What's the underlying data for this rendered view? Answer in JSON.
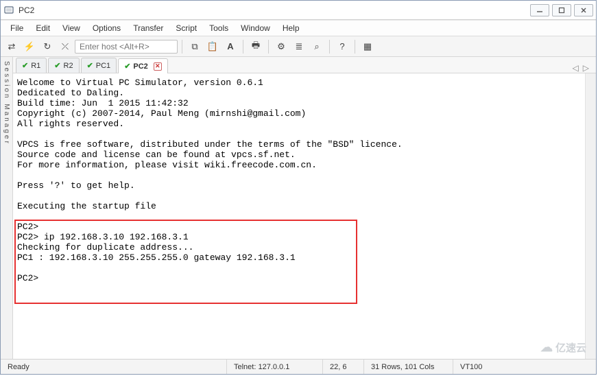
{
  "window": {
    "title": "PC2",
    "min_tip": "Minimize",
    "max_tip": "Maximize",
    "close_tip": "Close"
  },
  "menu": {
    "file": "File",
    "edit": "Edit",
    "view": "View",
    "options": "Options",
    "transfer": "Transfer",
    "script": "Script",
    "tools": "Tools",
    "window": "Window",
    "help": "Help"
  },
  "toolbar": {
    "host_placeholder": "Enter host <Alt+R>"
  },
  "session_manager_label": "Session Manager",
  "tabs": {
    "items": [
      {
        "label": "R1",
        "active": false
      },
      {
        "label": "R2",
        "active": false
      },
      {
        "label": "PC1",
        "active": false
      },
      {
        "label": "PC2",
        "active": true
      }
    ]
  },
  "terminal": {
    "header_lines": "Welcome to Virtual PC Simulator, version 0.6.1\nDedicated to Daling.\nBuild time: Jun  1 2015 11:42:32\nCopyright (c) 2007-2014, Paul Meng (mirnshi@gmail.com)\nAll rights reserved.\n\nVPCS is free software, distributed under the terms of the \"BSD\" licence.\nSource code and license can be found at vpcs.sf.net.\nFor more information, please visit wiki.freecode.com.cn.\n\nPress '?' to get help.\n\nExecuting the startup file\n",
    "boxed_lines": "PC2>\nPC2> ip 192.168.3.10 192.168.3.1\nChecking for duplicate address...\nPC1 : 192.168.3.10 255.255.255.0 gateway 192.168.3.1\n\nPC2>"
  },
  "status": {
    "ready": "Ready",
    "conn": "Telnet: 127.0.0.1",
    "pos": "22,   6",
    "size": "31 Rows, 101 Cols",
    "emul": "VT100"
  },
  "watermark": "亿速云"
}
